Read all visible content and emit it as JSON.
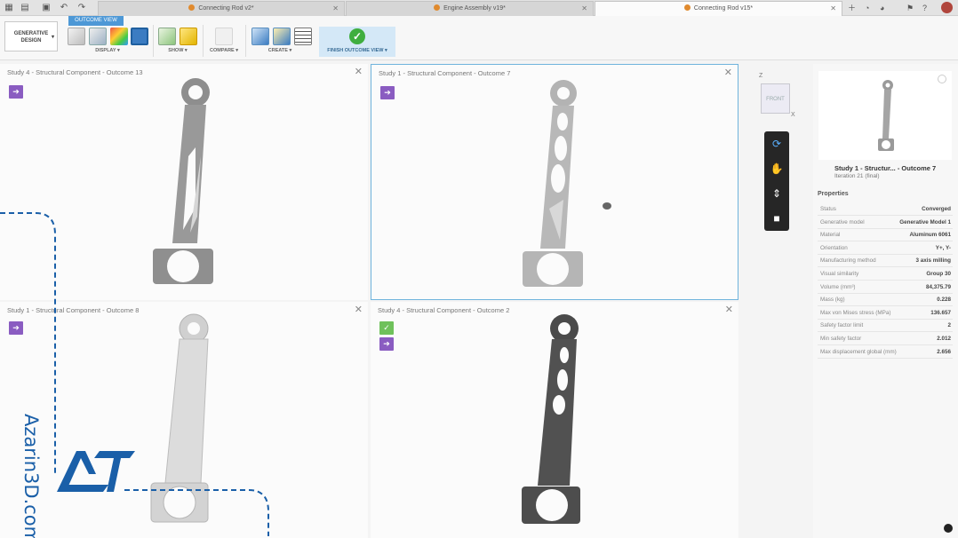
{
  "tabs": [
    {
      "doc": "Connecting Rod v2*",
      "active": false
    },
    {
      "doc": "Engine Assembly v19*",
      "active": false
    },
    {
      "doc": "Connecting Rod v15*",
      "active": true
    }
  ],
  "toolbar": {
    "workspace_line1": "GENERATIVE",
    "workspace_line2": "DESIGN",
    "context_tab": "OUTCOME VIEW",
    "groups": {
      "display": "DISPLAY ▾",
      "show": "SHOW ▾",
      "compare": "COMPARE ▾",
      "create": "CREATE ▾"
    },
    "finish": "FINISH OUTCOME VIEW ▾"
  },
  "panels": [
    {
      "title": "Study 4 - Structural Component - Outcome 13"
    },
    {
      "title": "Study 1 - Structural Component - Outcome 7"
    },
    {
      "title": "Study 1 - Structural Component - Outcome 8"
    },
    {
      "title": "Study 4 - Structural Component - Outcome 2"
    }
  ],
  "viewcube": {
    "up": "Z",
    "face": "FRONT",
    "axis": "X"
  },
  "properties": {
    "thumb_title": "Study 1 - Structur... - Outcome 7",
    "thumb_subtitle": "Iteration 21 (final)",
    "heading": "Properties",
    "rows": [
      {
        "key": "Status",
        "value": "Converged"
      },
      {
        "key": "Generative model",
        "value": "Generative Model 1"
      },
      {
        "key": "Material",
        "value": "Aluminum 6061"
      },
      {
        "key": "Orientation",
        "value": "Y+, Y-"
      },
      {
        "key": "Manufacturing method",
        "value": "3 axis milling"
      },
      {
        "key": "Visual similarity",
        "value": "Group 30"
      },
      {
        "key": "Volume (mm³)",
        "value": "84,375.79"
      },
      {
        "key": "Mass (kg)",
        "value": "0.228"
      },
      {
        "key": "Max von Mises stress (MPa)",
        "value": "136.657"
      },
      {
        "key": "Safety factor limit",
        "value": "2"
      },
      {
        "key": "Min safety factor",
        "value": "2.012"
      },
      {
        "key": "Max displacement global (mm)",
        "value": "2.656"
      }
    ]
  },
  "watermark": "Azarin3D.com",
  "colors": {
    "accent": "#4d98d6",
    "badge": "#8a5cc1",
    "badge_ok": "#6fc15b",
    "watermark": "#1a5fa8",
    "finish": "#3fae3f"
  }
}
